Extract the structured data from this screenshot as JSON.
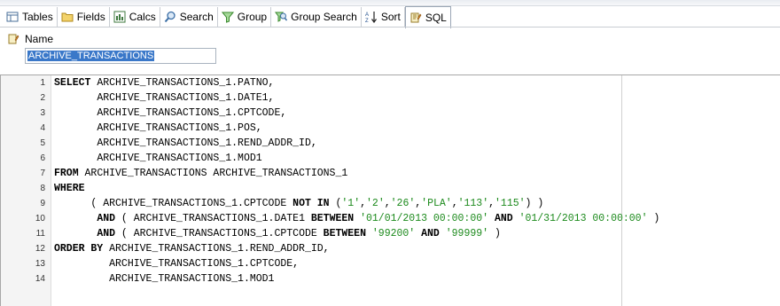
{
  "toolbar": {
    "tabs": [
      {
        "label": "Tables",
        "icon": "tables-icon"
      },
      {
        "label": "Fields",
        "icon": "fields-folder-icon"
      },
      {
        "label": "Calcs",
        "icon": "calcs-icon"
      },
      {
        "label": "Search",
        "icon": "search-icon"
      },
      {
        "label": "Group",
        "icon": "group-filter-icon"
      },
      {
        "label": "Group Search",
        "icon": "group-search-icon"
      },
      {
        "label": "Sort",
        "icon": "sort-az-icon"
      },
      {
        "label": "SQL",
        "icon": "sql-icon"
      }
    ],
    "active_tab": "SQL"
  },
  "name": {
    "label": "Name",
    "value": "ARCHIVE_TRANSACTIONS"
  },
  "sql_lines": [
    {
      "n": "1",
      "indent": "",
      "tokens": [
        {
          "t": "SELECT",
          "k": "kw"
        },
        {
          "t": " ARCHIVE_TRANSACTIONS_1.PATNO,",
          "k": ""
        }
      ]
    },
    {
      "n": "2",
      "indent": "       ",
      "tokens": [
        {
          "t": "ARCHIVE_TRANSACTIONS_1.DATE1,",
          "k": ""
        }
      ]
    },
    {
      "n": "3",
      "indent": "       ",
      "tokens": [
        {
          "t": "ARCHIVE_TRANSACTIONS_1.CPTCODE,",
          "k": ""
        }
      ]
    },
    {
      "n": "4",
      "indent": "       ",
      "tokens": [
        {
          "t": "ARCHIVE_TRANSACTIONS_1.POS,",
          "k": ""
        }
      ]
    },
    {
      "n": "5",
      "indent": "       ",
      "tokens": [
        {
          "t": "ARCHIVE_TRANSACTIONS_1.REND_ADDR_ID,",
          "k": ""
        }
      ]
    },
    {
      "n": "6",
      "indent": "       ",
      "tokens": [
        {
          "t": "ARCHIVE_TRANSACTIONS_1.MOD1",
          "k": ""
        }
      ]
    },
    {
      "n": "7",
      "indent": "",
      "tokens": [
        {
          "t": "FROM",
          "k": "kw"
        },
        {
          "t": " ARCHIVE_TRANSACTIONS ARCHIVE_TRANSACTIONS_1",
          "k": ""
        }
      ]
    },
    {
      "n": "8",
      "indent": "",
      "tokens": [
        {
          "t": "WHERE",
          "k": "kw"
        }
      ]
    },
    {
      "n": "9",
      "indent": "      ",
      "tokens": [
        {
          "t": "( ARCHIVE_TRANSACTIONS_1.CPTCODE ",
          "k": ""
        },
        {
          "t": "NOT IN",
          "k": "kw"
        },
        {
          "t": " (",
          "k": ""
        },
        {
          "t": "'1'",
          "k": "str"
        },
        {
          "t": ",",
          "k": ""
        },
        {
          "t": "'2'",
          "k": "str"
        },
        {
          "t": ",",
          "k": ""
        },
        {
          "t": "'26'",
          "k": "str"
        },
        {
          "t": ",",
          "k": ""
        },
        {
          "t": "'PLA'",
          "k": "str"
        },
        {
          "t": ",",
          "k": ""
        },
        {
          "t": "'113'",
          "k": "str"
        },
        {
          "t": ",",
          "k": ""
        },
        {
          "t": "'115'",
          "k": "str"
        },
        {
          "t": ") )",
          "k": ""
        }
      ]
    },
    {
      "n": "10",
      "indent": "       ",
      "tokens": [
        {
          "t": "AND",
          "k": "kw"
        },
        {
          "t": " ( ARCHIVE_TRANSACTIONS_1.DATE1 ",
          "k": ""
        },
        {
          "t": "BETWEEN",
          "k": "kw"
        },
        {
          "t": " ",
          "k": ""
        },
        {
          "t": "'01/01/2013 00:00:00'",
          "k": "str"
        },
        {
          "t": " ",
          "k": ""
        },
        {
          "t": "AND",
          "k": "kw"
        },
        {
          "t": " ",
          "k": ""
        },
        {
          "t": "'01/31/2013 00:00:00'",
          "k": "str"
        },
        {
          "t": " )",
          "k": ""
        }
      ]
    },
    {
      "n": "11",
      "indent": "       ",
      "tokens": [
        {
          "t": "AND",
          "k": "kw"
        },
        {
          "t": " ( ARCHIVE_TRANSACTIONS_1.CPTCODE ",
          "k": ""
        },
        {
          "t": "BETWEEN",
          "k": "kw"
        },
        {
          "t": " ",
          "k": ""
        },
        {
          "t": "'99200'",
          "k": "str"
        },
        {
          "t": " ",
          "k": ""
        },
        {
          "t": "AND",
          "k": "kw"
        },
        {
          "t": " ",
          "k": ""
        },
        {
          "t": "'99999'",
          "k": "str"
        },
        {
          "t": " )",
          "k": ""
        }
      ]
    },
    {
      "n": "12",
      "indent": "",
      "tokens": [
        {
          "t": "ORDER BY",
          "k": "kw"
        },
        {
          "t": " ARCHIVE_TRANSACTIONS_1.REND_ADDR_ID,",
          "k": ""
        }
      ]
    },
    {
      "n": "13",
      "indent": "         ",
      "tokens": [
        {
          "t": "ARCHIVE_TRANSACTIONS_1.CPTCODE,",
          "k": ""
        }
      ]
    },
    {
      "n": "14",
      "indent": "         ",
      "tokens": [
        {
          "t": "ARCHIVE_TRANSACTIONS_1.MOD1",
          "k": ""
        }
      ]
    }
  ],
  "colors": {
    "keyword": "#000000",
    "string": "#1c8a1c",
    "selection": "#3a78c9"
  }
}
